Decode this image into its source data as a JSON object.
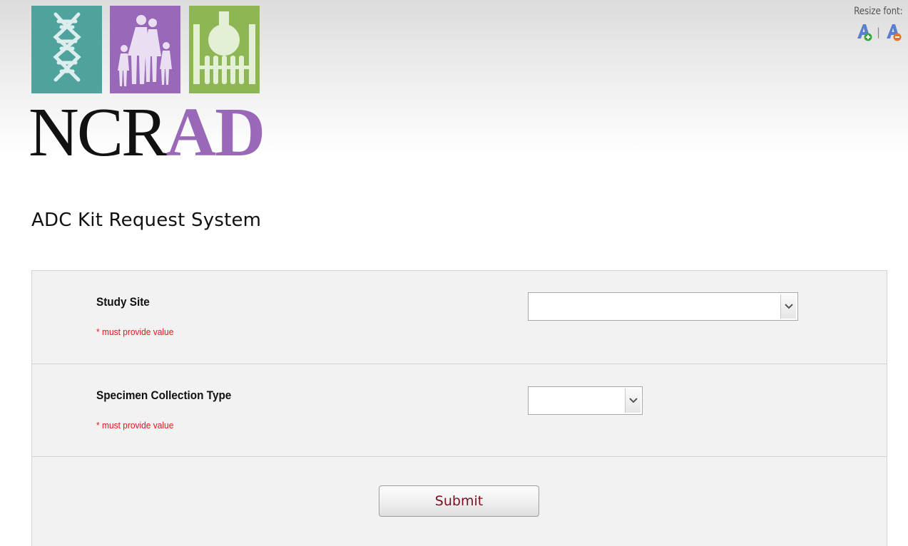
{
  "header": {
    "logo_text_dark": "NCR",
    "logo_text_accent": "AD",
    "logo_tiles": [
      {
        "icon": "dna-helix-icon",
        "color": "#4fa39c"
      },
      {
        "icon": "family-icon",
        "color": "#9a68b8"
      },
      {
        "icon": "lab-flask-icon",
        "color": "#8eb654"
      }
    ],
    "resize_font_label": "Resize font:",
    "resize_separator": "|"
  },
  "page": {
    "title": "ADC Kit Request System"
  },
  "form": {
    "fields": [
      {
        "label": "Study Site",
        "required_note": "* must provide value",
        "selected_value": ""
      },
      {
        "label": "Specimen Collection Type",
        "required_note": "* must provide value",
        "selected_value": ""
      }
    ],
    "submit_label": "Submit"
  },
  "colors": {
    "required_red": "#e8141c",
    "submit_text": "#7a1020",
    "logo_purple": "#9a68b8"
  }
}
